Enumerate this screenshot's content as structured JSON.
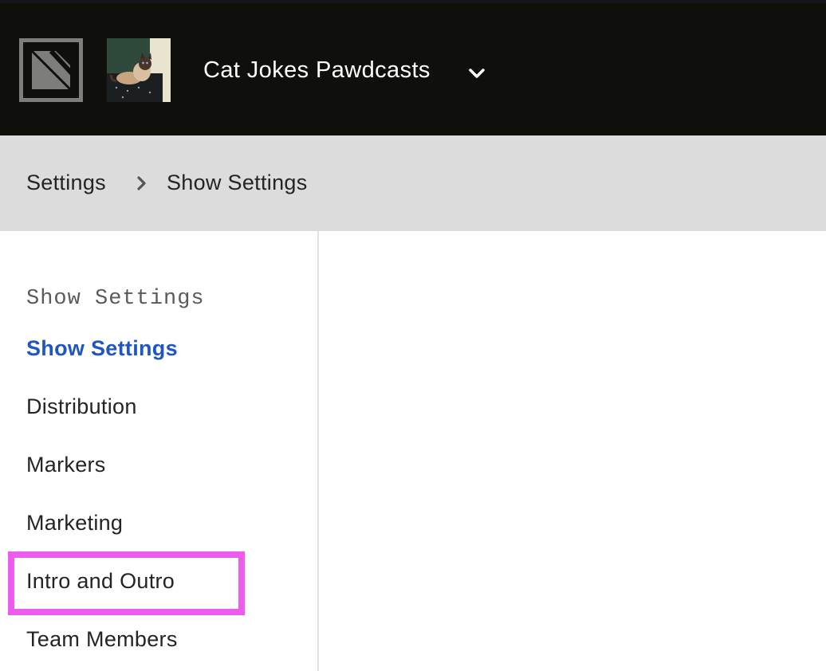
{
  "header": {
    "logo_icon": "app-logo-icon",
    "show_art_icon": "cat-show-artwork",
    "show_title": "Cat Jokes Pawdcasts",
    "dropdown_icon": "chevron-down-icon"
  },
  "breadcrumb": {
    "items": [
      "Settings",
      "Show Settings"
    ],
    "separator_icon": "chevron-right-icon"
  },
  "sidebar": {
    "section_heading": "Show Settings",
    "items": [
      {
        "label": "Show Settings",
        "active": true
      },
      {
        "label": "Distribution",
        "active": false
      },
      {
        "label": "Markers",
        "active": false
      },
      {
        "label": "Marketing",
        "active": false
      },
      {
        "label": "Intro and Outro",
        "active": false,
        "highlighted": true
      },
      {
        "label": "Team Members",
        "active": false
      }
    ]
  },
  "colors": {
    "topbar_bg": "#0f0f0c",
    "breadcrumb_bg": "#dcdcdc",
    "active_link": "#1f56c4",
    "highlight": "#ee5bef"
  }
}
